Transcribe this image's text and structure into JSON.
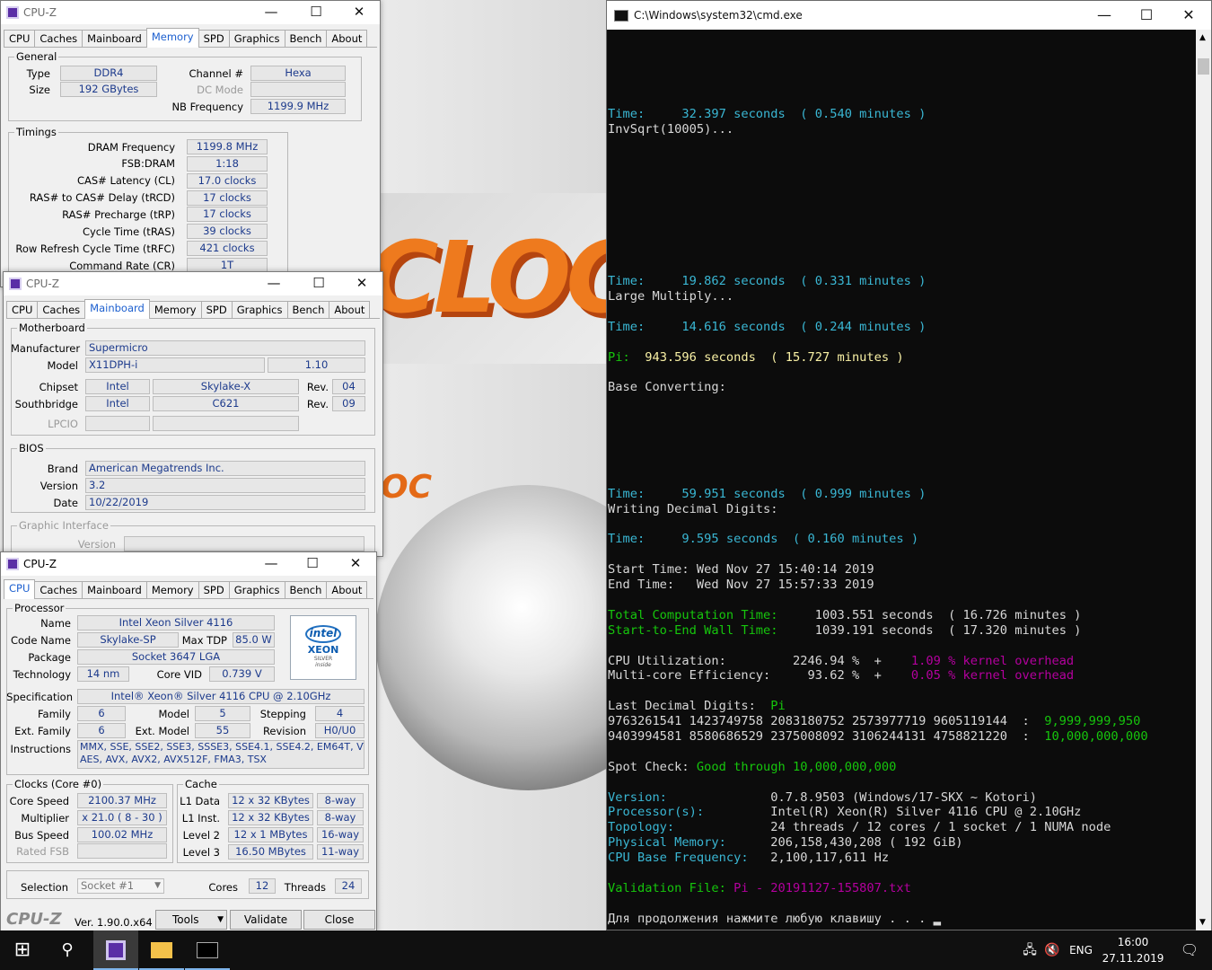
{
  "app": {
    "cpuz_title": "CPU-Z",
    "cmd_title": "C:\\Windows\\system32\\cmd.exe"
  },
  "tabs": [
    "CPU",
    "Caches",
    "Mainboard",
    "Memory",
    "SPD",
    "Graphics",
    "Bench",
    "About"
  ],
  "memory": {
    "general_title": "General",
    "type_label": "Type",
    "type": "DDR4",
    "size_label": "Size",
    "size": "192 GBytes",
    "channel_label": "Channel #",
    "channel": "Hexa",
    "dcmode_label": "DC Mode",
    "nbfreq_label": "NB Frequency",
    "nbfreq": "1199.9 MHz",
    "timings_title": "Timings",
    "timings": [
      {
        "label": "DRAM Frequency",
        "value": "1199.8 MHz"
      },
      {
        "label": "FSB:DRAM",
        "value": "1:18"
      },
      {
        "label": "CAS# Latency (CL)",
        "value": "17.0 clocks"
      },
      {
        "label": "RAS# to CAS# Delay (tRCD)",
        "value": "17 clocks"
      },
      {
        "label": "RAS# Precharge (tRP)",
        "value": "17 clocks"
      },
      {
        "label": "Cycle Time (tRAS)",
        "value": "39 clocks"
      },
      {
        "label": "Row Refresh Cycle Time (tRFC)",
        "value": "421 clocks"
      },
      {
        "label": "Command Rate (CR)",
        "value": "1T"
      }
    ]
  },
  "mainboard": {
    "mb_title": "Motherboard",
    "manufacturer_label": "Manufacturer",
    "manufacturer": "Supermicro",
    "model_label": "Model",
    "model": "X11DPH-i",
    "model_rev": "1.10",
    "chipset_label": "Chipset",
    "chipset_vendor": "Intel",
    "chipset": "Skylake-X",
    "rev_label": "Rev.",
    "chipset_rev": "04",
    "south_label": "Southbridge",
    "south_vendor": "Intel",
    "south": "C621",
    "south_rev": "09",
    "lpcio_label": "LPCIO",
    "bios_title": "BIOS",
    "brand_label": "Brand",
    "brand": "American Megatrends Inc.",
    "version_label": "Version",
    "version": "3.2",
    "date_label": "Date",
    "date": "10/22/2019",
    "gi_title": "Graphic Interface",
    "gi_version_label": "Version"
  },
  "cpu": {
    "proc_title": "Processor",
    "name_label": "Name",
    "name": "Intel Xeon Silver 4116",
    "codename_label": "Code Name",
    "codename": "Skylake-SP",
    "maxtdp_label": "Max TDP",
    "maxtdp": "85.0 W",
    "package_label": "Package",
    "package": "Socket 3647 LGA",
    "tech_label": "Technology",
    "tech": "14 nm",
    "corevid_label": "Core VID",
    "corevid": "0.739 V",
    "spec_label": "Specification",
    "spec": "Intel® Xeon® Silver 4116 CPU @ 2.10GHz",
    "family_label": "Family",
    "family": "6",
    "model_label": "Model",
    "model": "5",
    "stepping_label": "Stepping",
    "stepping": "4",
    "extfamily_label": "Ext. Family",
    "extfamily": "6",
    "extmodel_label": "Ext. Model",
    "extmodel": "55",
    "revision_label": "Revision",
    "revision": "H0/U0",
    "instr_label": "Instructions",
    "instr1": "MMX, SSE, SSE2, SSE3, SSSE3, SSE4.1, SSE4.2, EM64T, VT-x,",
    "instr2": "AES, AVX, AVX2, AVX512F, FMA3, TSX",
    "logo_brand": "intel",
    "logo_line": "XEON",
    "logo_sub": "SILVER",
    "logo_inside": "inside",
    "clocks_title": "Clocks (Core #0)",
    "corespeed_label": "Core Speed",
    "corespeed": "2100.37 MHz",
    "mult_label": "Multiplier",
    "mult": "x 21.0 ( 8 - 30 )",
    "bus_label": "Bus Speed",
    "bus": "100.02 MHz",
    "fsb_label": "Rated FSB",
    "cache_title": "Cache",
    "cache": [
      {
        "label": "L1 Data",
        "size": "12 x 32 KBytes",
        "way": "8-way"
      },
      {
        "label": "L1 Inst.",
        "size": "12 x 32 KBytes",
        "way": "8-way"
      },
      {
        "label": "Level 2",
        "size": "12 x 1 MBytes",
        "way": "16-way"
      },
      {
        "label": "Level 3",
        "size": "16.50 MBytes",
        "way": "11-way"
      }
    ],
    "selection_label": "Selection",
    "selection": "Socket #1",
    "cores_label": "Cores",
    "cores": "12",
    "threads_label": "Threads",
    "threads": "24",
    "logo": "CPU-Z",
    "ver": "Ver. 1.90.0.x64",
    "tools": "Tools",
    "validate": "Validate",
    "close": "Close"
  },
  "terminal": [
    [],
    [],
    [],
    [],
    [],
    [
      [
        "c",
        "Time:     32.397 seconds  ( 0.540 minutes )"
      ]
    ],
    [
      [
        "w",
        "InvSqrt(10005)..."
      ]
    ],
    [],
    [],
    [],
    [],
    [],
    [],
    [],
    [],
    [],
    [
      [
        "c",
        "Time:     19.862 seconds  ( 0.331 minutes )"
      ]
    ],
    [
      [
        "w",
        "Large Multiply..."
      ]
    ],
    [],
    [
      [
        "c",
        "Time:     14.616 seconds  ( 0.244 minutes )"
      ]
    ],
    [],
    [
      [
        "g",
        "Pi: "
      ],
      [
        "y",
        " 943.596 seconds  ( 15.727 minutes )"
      ]
    ],
    [],
    [
      [
        "w",
        "Base Converting:"
      ]
    ],
    [],
    [],
    [],
    [],
    [],
    [],
    [
      [
        "c",
        "Time:     59.951 seconds  ( 0.999 minutes )"
      ]
    ],
    [
      [
        "w",
        "Writing Decimal Digits:"
      ]
    ],
    [],
    [
      [
        "c",
        "Time:     9.595 seconds  ( 0.160 minutes )"
      ]
    ],
    [],
    [
      [
        "w",
        "Start Time: Wed Nov 27 15:40:14 2019"
      ]
    ],
    [
      [
        "w",
        "End Time:   Wed Nov 27 15:57:33 2019"
      ]
    ],
    [],
    [
      [
        "g",
        "Total Computation Time:"
      ],
      [
        "w",
        "     1003.551 seconds  ( 16.726 minutes )"
      ]
    ],
    [
      [
        "g",
        "Start-to-End Wall Time:"
      ],
      [
        "w",
        "     1039.191 seconds  ( 17.320 minutes )"
      ]
    ],
    [],
    [
      [
        "w",
        "CPU Utilization:         2246.94 %  +    "
      ],
      [
        "m",
        "1.09 % kernel overhead"
      ]
    ],
    [
      [
        "w",
        "Multi-core Efficiency:     93.62 %  +    "
      ],
      [
        "m",
        "0.05 % kernel overhead"
      ]
    ],
    [],
    [
      [
        "w",
        "Last Decimal Digits:  "
      ],
      [
        "g",
        "Pi"
      ]
    ],
    [
      [
        "w",
        "9763261541 1423749758 2083180752 2573977719 9605119144  :  "
      ],
      [
        "g",
        "9,999,999,950"
      ]
    ],
    [
      [
        "w",
        "9403994581 8580686529 2375008092 3106244131 4758821220  :  "
      ],
      [
        "g",
        "10,000,000,000"
      ]
    ],
    [],
    [
      [
        "w",
        "Spot Check: "
      ],
      [
        "g",
        "Good through 10,000,000,000"
      ]
    ],
    [],
    [
      [
        "c",
        "Version:              "
      ],
      [
        "w",
        "0.7.8.9503 (Windows/17-SKX ~ Kotori)"
      ]
    ],
    [
      [
        "c",
        "Processor(s):         "
      ],
      [
        "w",
        "Intel(R) Xeon(R) Silver 4116 CPU @ 2.10GHz"
      ]
    ],
    [
      [
        "c",
        "Topology:             "
      ],
      [
        "w",
        "24 threads / 12 cores / 1 socket / 1 NUMA node"
      ]
    ],
    [
      [
        "c",
        "Physical Memory:      "
      ],
      [
        "w",
        "206,158,430,208 ( 192 GiB)"
      ]
    ],
    [
      [
        "c",
        "CPU Base Frequency:   "
      ],
      [
        "w",
        "2,100,117,611 Hz"
      ]
    ],
    [],
    [
      [
        "g",
        "Validation File: "
      ],
      [
        "m",
        "Pi - 20191127-155807.txt"
      ]
    ],
    [],
    [
      [
        "w",
        "Для продолжения нажмите любую клавишу . . . "
      ],
      [
        "w",
        "▂"
      ]
    ]
  ],
  "taskbar": {
    "lang": "ENG",
    "time": "16:00",
    "date": "27.11.2019"
  }
}
